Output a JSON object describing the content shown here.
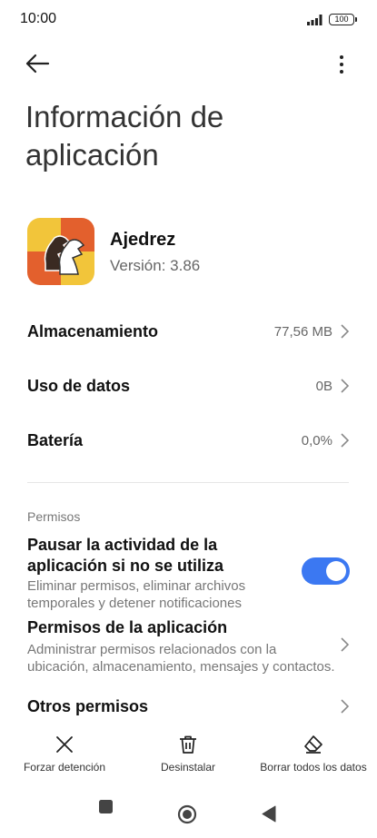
{
  "status_bar": {
    "time": "10:00",
    "battery": "100"
  },
  "header": {
    "title": "Información de aplicación"
  },
  "app": {
    "name": "Ajedrez",
    "version": "Versión: 3.86"
  },
  "rows": [
    {
      "label": "Almacenamiento",
      "value": "77,56 MB"
    },
    {
      "label": "Uso de datos",
      "value": "0B"
    },
    {
      "label": "Batería",
      "value": "0,0%"
    }
  ],
  "permissions": {
    "section_label": "Permisos",
    "pause": {
      "title": "Pausar la actividad de la aplicación si no se utiliza",
      "subtitle": "Eliminar permisos, eliminar archivos temporales y detener notificaciones",
      "enabled": true
    },
    "app_permissions": {
      "title": "Permisos de la aplicación",
      "subtitle": "Administrar permisos relacionados con la ubicación, almacenamiento, mensajes y contactos."
    },
    "other": {
      "title": "Otros permisos"
    }
  },
  "actions": {
    "force_stop": "Forzar detención",
    "uninstall": "Desinstalar",
    "clear_data": "Borrar todos los datos"
  },
  "colors": {
    "accent": "#3b78f2"
  },
  "icons": {
    "back": "arrow-left-icon",
    "more": "more-vertical-icon",
    "force_stop": "close-icon",
    "uninstall": "trash-icon",
    "clear": "eraser-icon",
    "nav_recents": "square-icon",
    "nav_home": "circle-icon",
    "nav_back": "triangle-back-icon"
  }
}
